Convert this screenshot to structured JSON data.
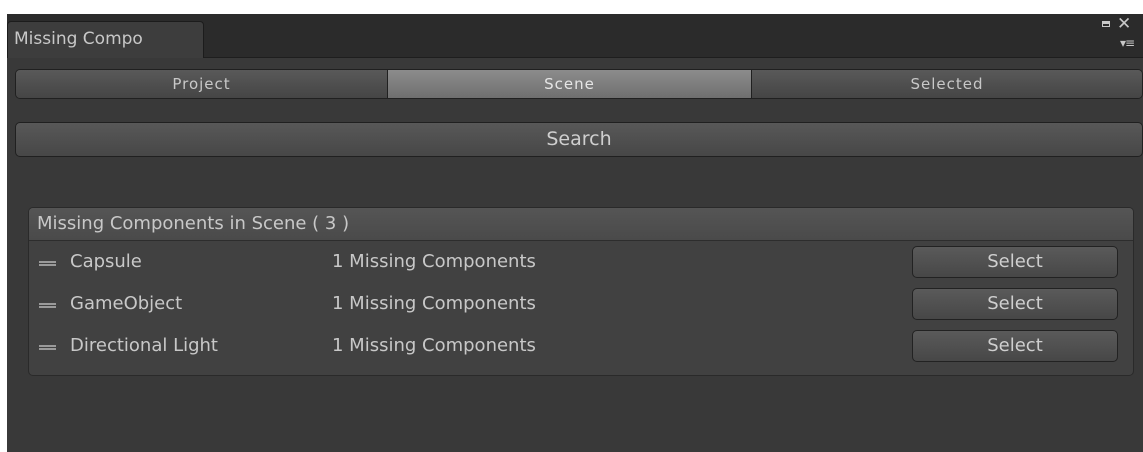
{
  "window": {
    "tab_title": "Missing Compo",
    "close_glyph": "✕",
    "menu_glyph": "▾≡"
  },
  "toolbar": {
    "tabs": [
      {
        "label": "Project",
        "active": false
      },
      {
        "label": "Scene",
        "active": true
      },
      {
        "label": "Selected",
        "active": false
      }
    ]
  },
  "search_button": {
    "label": "Search"
  },
  "results": {
    "header": "Missing Components in Scene ( 3 )",
    "rows": [
      {
        "name": "Capsule",
        "count": "1 Missing Components",
        "button": "Select"
      },
      {
        "name": "GameObject",
        "count": "1 Missing Components",
        "button": "Select"
      },
      {
        "name": "Directional Light",
        "count": "1 Missing Components",
        "button": "Select"
      }
    ]
  },
  "icons": {
    "maximize": "maximize-icon",
    "close": "close-icon",
    "menu": "menu-icon",
    "row_handle": "drag-handle-icon"
  },
  "colors": {
    "window_bg": "#393939",
    "active_tab": "#8c8c8c",
    "text": "#c8c8c8"
  }
}
